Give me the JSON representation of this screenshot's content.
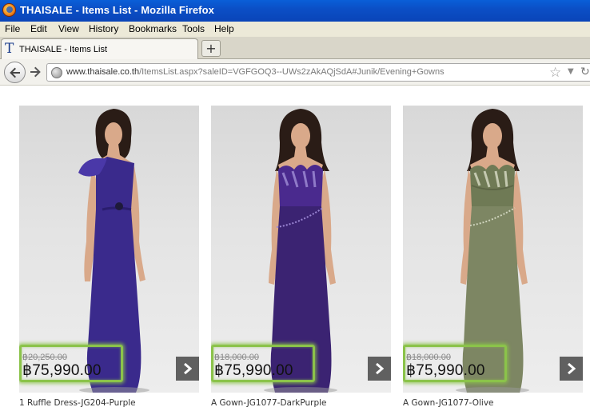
{
  "window": {
    "title": "THAISALE - Items List - Mozilla Firefox"
  },
  "menu": [
    "File",
    "Edit",
    "View",
    "History",
    "Bookmarks",
    "Tools",
    "Help"
  ],
  "tab": {
    "label": "THAISALE - Items List",
    "new_tab_label": "+"
  },
  "address": {
    "host": "www.thaisale.co.th",
    "path": "/ItemsList.aspx?saleID=VGFGOQ3--UWs2zAkAQjSdA#Junik/Evening+Gowns"
  },
  "products": [
    {
      "name": "1 Ruffle Dress-JG204-Purple",
      "old_price": "฿20,250.00",
      "price": "฿75,990.00",
      "color": "#3a2a8c"
    },
    {
      "name": "A Gown-JG1077-DarkPurple",
      "old_price": "฿18,000.00",
      "price": "฿75,990.00",
      "color": "#3b2372"
    },
    {
      "name": "A Gown-JG1077-Olive",
      "old_price": "฿18,000.00",
      "price": "฿75,990.00",
      "color": "#7d8663"
    }
  ],
  "colors": {
    "titlebar": "#0b4fc6",
    "price_highlight": "#8bc34a"
  }
}
